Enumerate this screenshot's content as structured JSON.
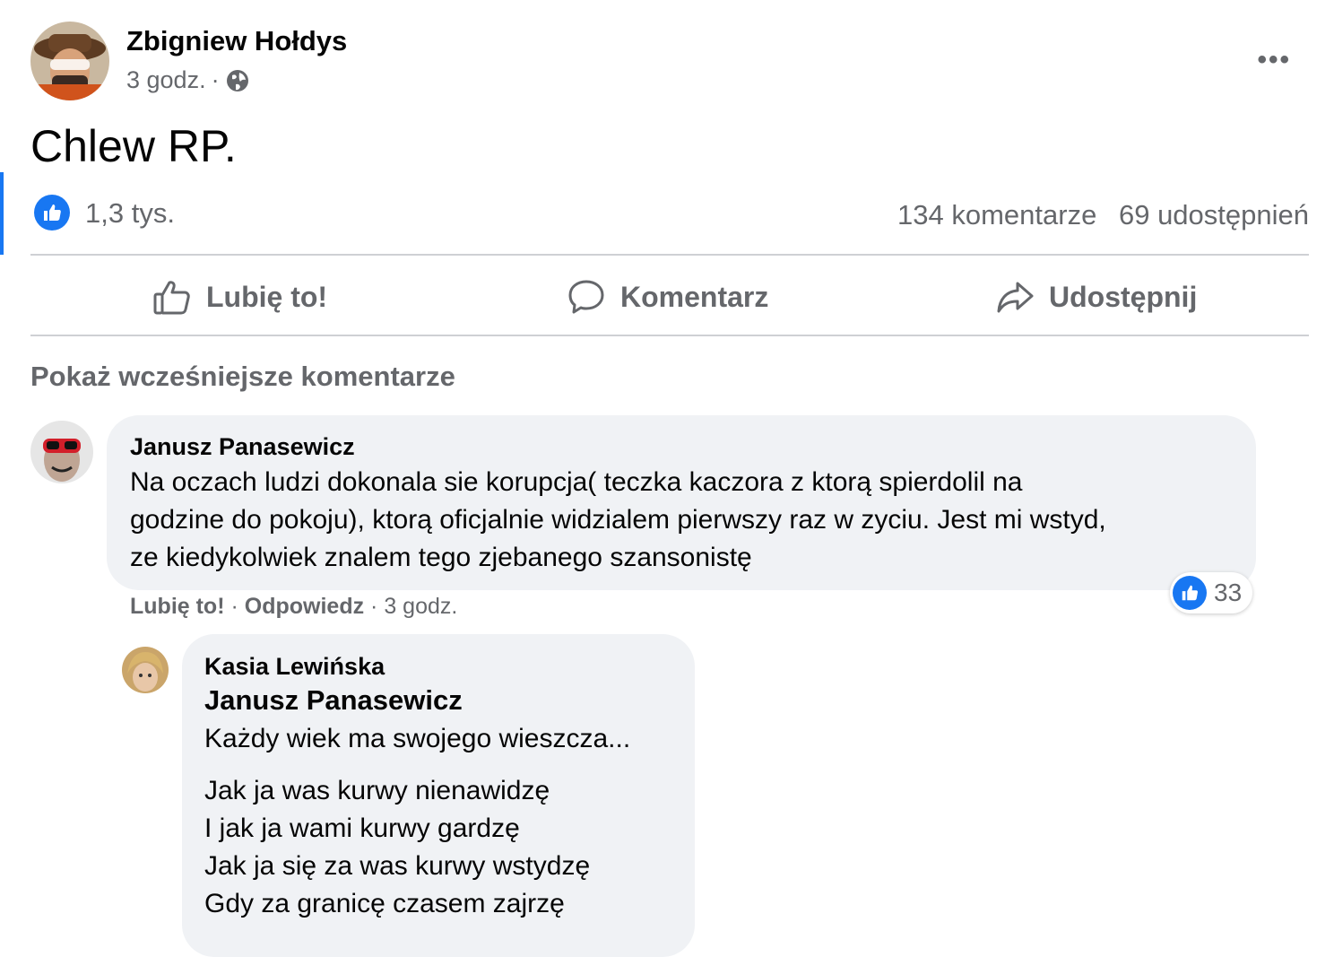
{
  "post": {
    "author": "Zbigniew Hołdys",
    "time": "3 godz.",
    "separator": "·",
    "audience_icon": "globe-icon",
    "text": "Chlew RP.",
    "reactions_count": "1,3 tys.",
    "comments_count": "134 komentarze",
    "shares_count": "69 udostępnień"
  },
  "actions": {
    "like": "Lubię to!",
    "comment": "Komentarz",
    "share": "Udostępnij"
  },
  "show_previous_comments": "Pokaż wcześniejsze komentarze",
  "comments": [
    {
      "author": "Janusz Panasewicz",
      "lines": [
        "Na oczach ludzi dokonala sie korupcja( teczka kaczora z ktorą spierdolil na",
        "godzine do pokoju), ktorą oficjalnie widzialem pierwszy raz w zyciu. Jest mi wstyd,",
        "ze kiedykolwiek znalem tego zjebanego szansonistę"
      ],
      "like_label": "Lubię to!",
      "reply_label": "Odpowiedz",
      "time": "3 godz.",
      "separator": "·",
      "reaction_count": "33"
    }
  ],
  "reply": {
    "author": "Kasia Lewińska",
    "mention": "Janusz Panasewicz",
    "lines": [
      "Każdy wiek ma swojego wieszcza...",
      "",
      "Jak ja was kurwy nienawidzę",
      "I jak ja wami kurwy gardzę",
      "Jak ja się za was kurwy wstydzę",
      "Gdy za granicę czasem zajrzę"
    ]
  },
  "colors": {
    "accent": "#1877f2",
    "secondary_text": "#65676b",
    "bubble_bg": "#f0f2f5",
    "divider": "#ced0d4"
  }
}
